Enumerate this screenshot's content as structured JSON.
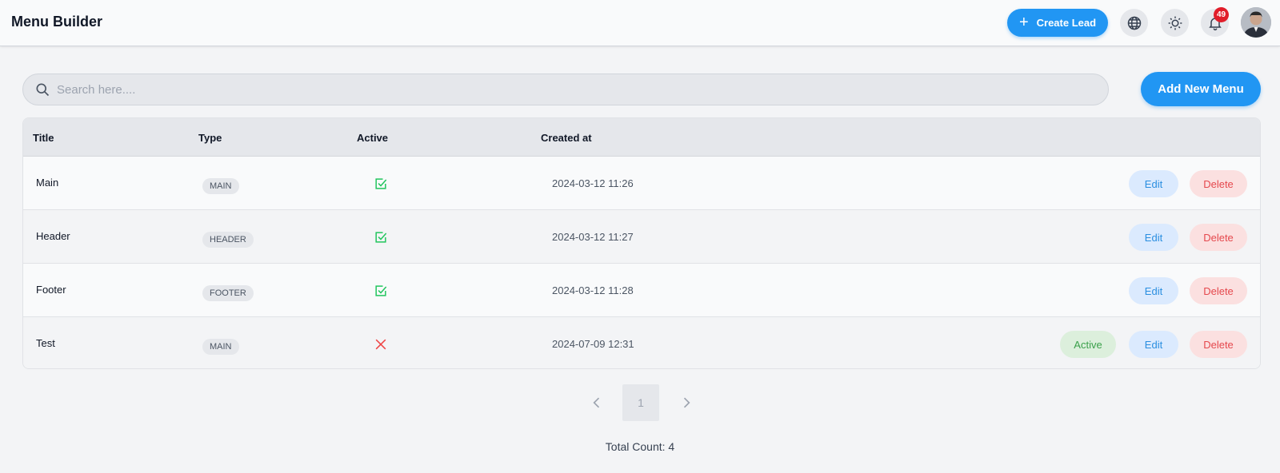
{
  "header": {
    "title": "Menu Builder",
    "create_lead_label": "Create Lead",
    "notification_count": "49"
  },
  "toolbar": {
    "search_placeholder": "Search here....",
    "search_value": "",
    "add_menu_label": "Add New Menu"
  },
  "table": {
    "columns": [
      "Title",
      "Type",
      "Active",
      "Created at"
    ],
    "rows": [
      {
        "title": "Main",
        "type": "MAIN",
        "active": true,
        "created_at": "2024-03-12 11:26",
        "edit_label": "Edit",
        "delete_label": "Delete"
      },
      {
        "title": "Header",
        "type": "HEADER",
        "active": true,
        "created_at": "2024-03-12 11:27",
        "edit_label": "Edit",
        "delete_label": "Delete"
      },
      {
        "title": "Footer",
        "type": "FOOTER",
        "active": true,
        "created_at": "2024-03-12 11:28",
        "edit_label": "Edit",
        "delete_label": "Delete"
      },
      {
        "title": "Test",
        "type": "MAIN",
        "active": false,
        "created_at": "2024-07-09 12:31",
        "activate_label": "Active",
        "edit_label": "Edit",
        "delete_label": "Delete"
      }
    ]
  },
  "pagination": {
    "current_page": "1",
    "total_count_text": "Total Count: 4"
  },
  "colors": {
    "primary": "#2196f3",
    "active_check": "#22c55e",
    "inactive_x": "#ef4444",
    "badge": "#e11d2a"
  },
  "icons": {
    "globe": "globe-icon",
    "theme": "sun-icon",
    "bell": "bell-icon",
    "search": "search-icon",
    "active": "checkbox-check-icon",
    "inactive": "close-icon",
    "prev": "chevron-left-icon",
    "next": "chevron-right-icon"
  }
}
